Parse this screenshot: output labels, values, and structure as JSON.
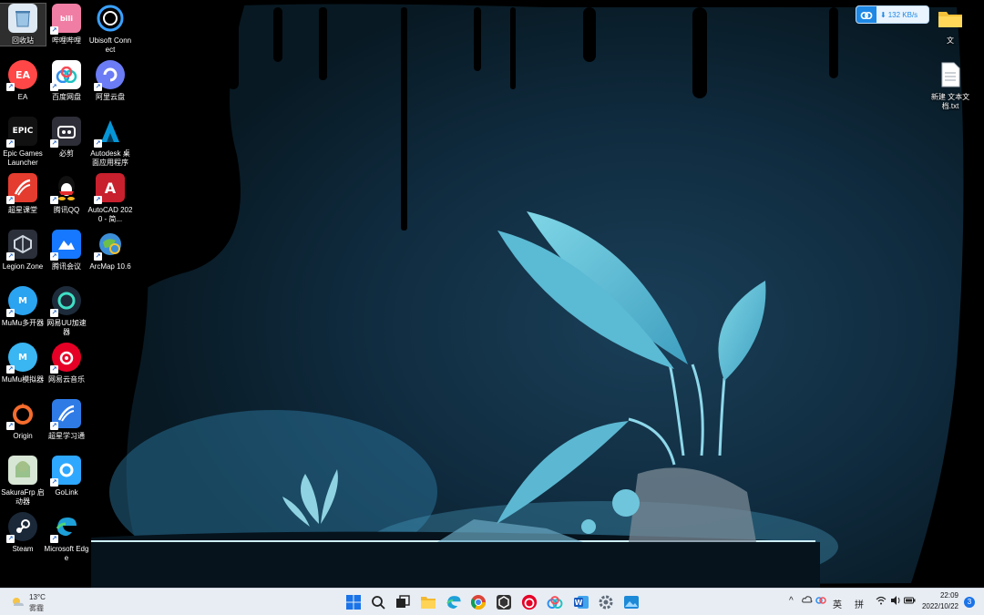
{
  "desktop": {
    "icons": [
      {
        "label": "回收站",
        "icon": "recycle-bin-icon"
      },
      {
        "label": "哔哩哔哩",
        "icon": "bilibili-icon"
      },
      {
        "label": "Ubisoft Connect",
        "icon": "ubisoft-icon"
      },
      {
        "label": "EA",
        "icon": "ea-icon"
      },
      {
        "label": "百度网盘",
        "icon": "baidu-netdisk-icon"
      },
      {
        "label": "阿里云盘",
        "icon": "aliyun-drive-icon"
      },
      {
        "label": "Epic Games Launcher",
        "icon": "epic-games-icon",
        "badge": "EPIC"
      },
      {
        "label": "必剪",
        "icon": "bijian-icon"
      },
      {
        "label": "Autodesk 桌面应用程序",
        "icon": "autodesk-icon"
      },
      {
        "label": "超星课堂",
        "icon": "chaoxing-icon"
      },
      {
        "label": "腾讯QQ",
        "icon": "qq-icon"
      },
      {
        "label": "AutoCAD 2020 - 简...",
        "icon": "autocad-icon"
      },
      {
        "label": "Legion Zone",
        "icon": "legion-zone-icon"
      },
      {
        "label": "腾讯会议",
        "icon": "tencent-meeting-icon"
      },
      {
        "label": "ArcMap 10.6",
        "icon": "arcmap-icon"
      },
      {
        "label": "MuMu多开器",
        "icon": "mumu-multi-icon"
      },
      {
        "label": "网易UU加速器",
        "icon": "uu-accelerator-icon"
      },
      {
        "label": "MuMu模拟器",
        "icon": "mumu-emulator-icon"
      },
      {
        "label": "网易云音乐",
        "icon": "netease-music-icon"
      },
      {
        "label": "Origin",
        "icon": "origin-icon"
      },
      {
        "label": "超星学习通",
        "icon": "xuexitong-icon"
      },
      {
        "label": "SakuraFrp 启动器",
        "icon": "sakurafrp-icon"
      },
      {
        "label": "GoLink",
        "icon": "golink-icon"
      },
      {
        "label": "Steam",
        "icon": "steam-icon"
      },
      {
        "label": "Microsoft Edge",
        "icon": "edge-icon"
      }
    ],
    "right_icons": [
      {
        "label": "文",
        "icon": "folder-icon"
      },
      {
        "label": "新建 文本文档.txt",
        "icon": "text-file-icon"
      }
    ]
  },
  "widget": {
    "speed": "132 KB/s",
    "icon": "baidu-netdisk-icon"
  },
  "taskbar": {
    "weather": {
      "temp": "13°C",
      "desc": "雾霾",
      "icon": "weather-haze-icon"
    },
    "apps": [
      "start-icon",
      "search-icon",
      "task-view-icon",
      "file-explorer-icon",
      "edge-icon",
      "chrome-icon",
      "unity-icon",
      "netease-music-icon",
      "baidu-netdisk-icon",
      "word-icon",
      "settings-icon",
      "photos-icon"
    ],
    "tray": {
      "ime_lang": "英",
      "ime_mode": "拼",
      "time": "22:09",
      "date": "2022/10/22",
      "notifications": "3"
    }
  },
  "colors": {
    "taskbar_bg": "#e8edf4",
    "accent": "#1e88e5",
    "wallpaper_teal": "#6fc6dc"
  }
}
